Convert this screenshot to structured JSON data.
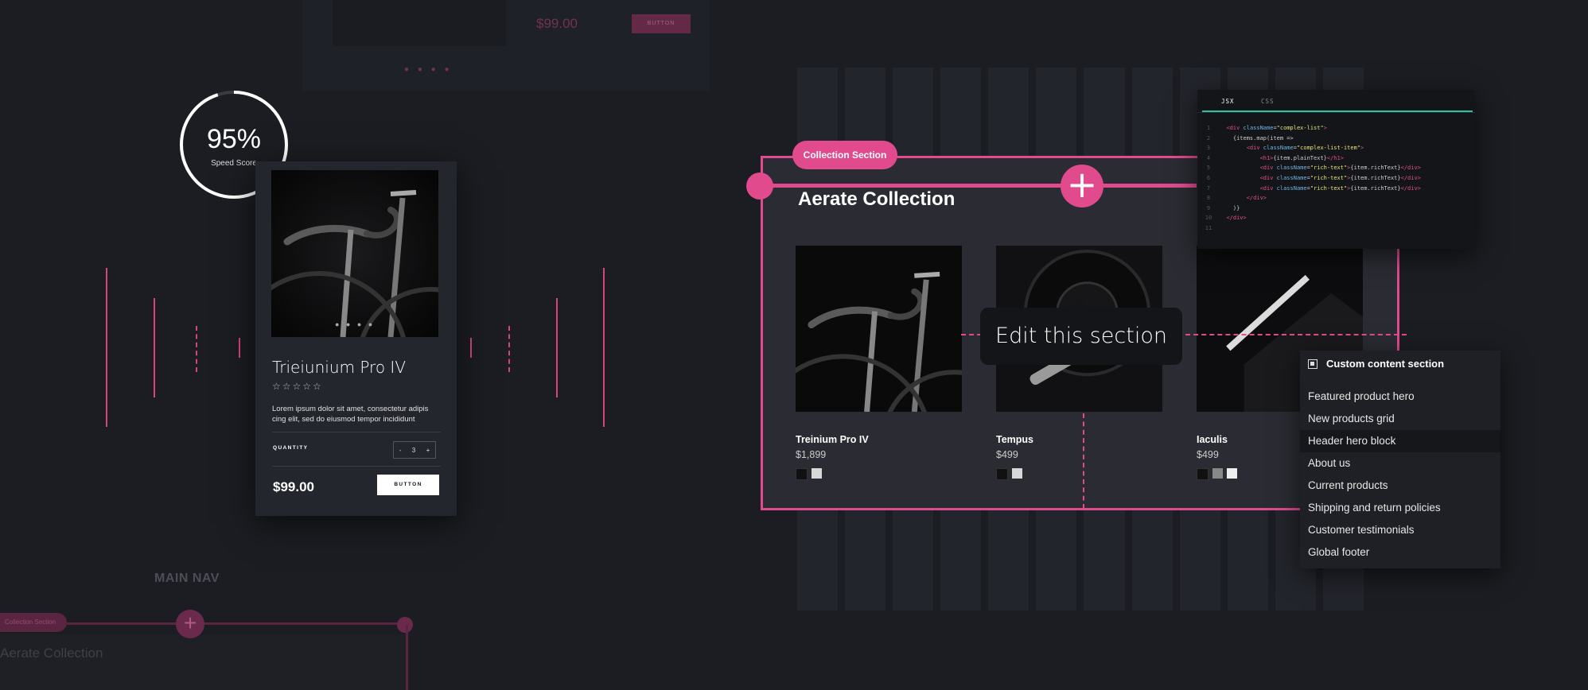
{
  "top_card": {
    "price": "$99.00",
    "button_label": "BUTTON"
  },
  "speed_score": {
    "value": "95%",
    "label": "Speed Score",
    "fraction": 0.95
  },
  "product_card": {
    "name": "Trieiunium Pro IV",
    "stars": "☆☆☆☆☆",
    "description": "Lorem ipsum dolor sit amet, consectetur adipis cing elit, sed do eiusmod tempor incididunt",
    "quantity_label": "QUANTITY",
    "quantity_minus": "-",
    "quantity_value": "3",
    "quantity_plus": "+",
    "price": "$99.00",
    "button_label": "BUTTON"
  },
  "bottom_left": {
    "main_nav": "MAIN NAV",
    "section_tag": "Collection Section",
    "plus": "+",
    "title": "Aerate Collection"
  },
  "collection": {
    "tag": "Collection Section",
    "plus": "+",
    "title": "Aerate Collection",
    "products": [
      {
        "name": "Treinium Pro IV",
        "price": "$1,899",
        "swatches": [
          "#111111",
          "#d8d8d8"
        ]
      },
      {
        "name": "Tempus",
        "price": "$499",
        "swatches": [
          "#111111",
          "#d8d8d8"
        ]
      },
      {
        "name": "Iaculis",
        "price": "$499",
        "swatches": [
          "#111111",
          "#888888",
          "#eeeeee"
        ]
      }
    ],
    "tooltip": "Edit this section"
  },
  "code_editor": {
    "tabs": [
      "JSX",
      "CSS"
    ],
    "active_tab": "JSX"
  },
  "content_menu": {
    "title": "Custom content section",
    "items": [
      "Featured product hero",
      "New products grid",
      "Header hero block",
      "About us",
      "Current products",
      "Shipping and return policies",
      "Customer testimonials",
      "Global footer"
    ],
    "selected_index": 2
  },
  "colors": {
    "accent": "#e14b8e",
    "background": "#1b1d22",
    "code_underline": "#2bc0a0"
  }
}
